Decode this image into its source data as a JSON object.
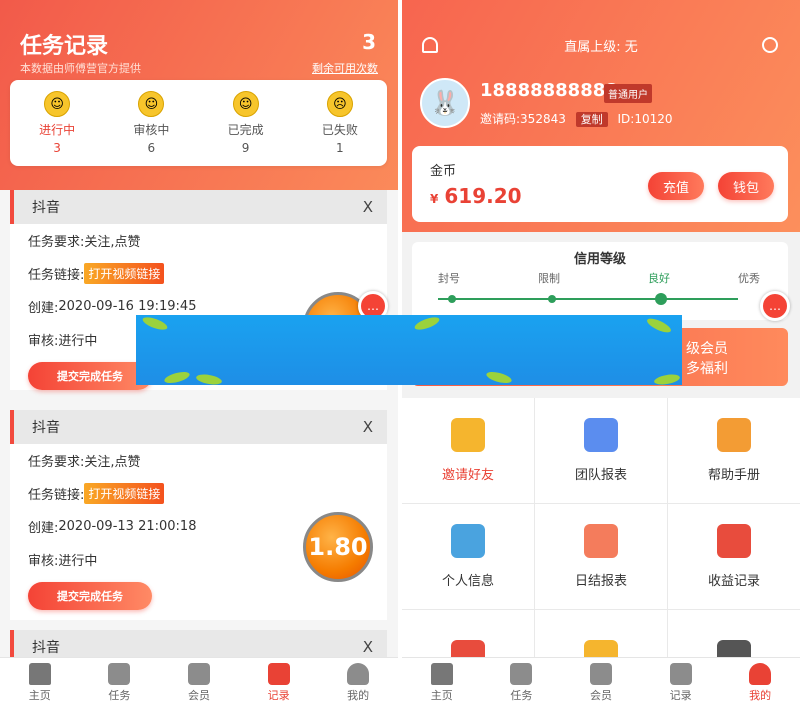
{
  "left": {
    "title": "任务记录",
    "subtitle": "本数据由师傅营官方提供",
    "remaining_count": "3",
    "remaining_label": "剩余可用次数",
    "stats": [
      {
        "label": "进行中",
        "count": "3",
        "active": true
      },
      {
        "label": "审核中",
        "count": "6",
        "active": false
      },
      {
        "label": "已完成",
        "count": "9",
        "active": false
      },
      {
        "label": "已失败",
        "count": "1",
        "active": false
      }
    ],
    "tasks": [
      {
        "platform": "抖音",
        "close": "X",
        "req_label": "任务要求: ",
        "req": "关注,点赞",
        "link_label": "任务链接:",
        "link_btn": "打开视频链接",
        "created_label": "创建: ",
        "created": "2020-09-16 19:19:45",
        "review_label": "审核: ",
        "review": "进行中",
        "submit": "提交完成任务"
      },
      {
        "platform": "抖音",
        "close": "X",
        "req_label": "任务要求: ",
        "req": "关注,点赞",
        "link_label": "任务链接:",
        "link_btn": "打开视频链接",
        "created_label": "创建: ",
        "created": "2020-09-13 21:00:18",
        "review_label": "审核: ",
        "review": "进行中",
        "submit": "提交完成任务",
        "reward": "1.80"
      },
      {
        "platform": "抖音",
        "close": "X"
      }
    ],
    "nav": [
      "主页",
      "任务",
      "会员",
      "记录",
      "我的"
    ],
    "nav_active": 3
  },
  "right": {
    "superior": "直属上级: 无",
    "phone": "18888888888",
    "user_level": "普通用户",
    "invite_label": "邀请码:",
    "invite_code": "352843",
    "copy": "复制",
    "id_label": "ID:",
    "id": "10120",
    "coin_label": "金币",
    "currency": "¥",
    "coin_amount": "619.20",
    "recharge": "充值",
    "wallet": "钱包",
    "credit_title": "信用等级",
    "credit_levels": [
      "封号",
      "限制",
      "良好",
      "优秀"
    ],
    "promo_line1": "级会员",
    "promo_line2": "多福利",
    "menu": [
      {
        "label": "邀请好友",
        "icon": "gift-icon",
        "color": "#f5b52e"
      },
      {
        "label": "团队报表",
        "icon": "layers-icon",
        "color": "#5b8def"
      },
      {
        "label": "帮助手册",
        "icon": "help-icon",
        "color": "#f39c34"
      },
      {
        "label": "个人信息",
        "icon": "id-card-icon",
        "color": "#4aa3df"
      },
      {
        "label": "日结报表",
        "icon": "bar-chart-icon",
        "color": "#f47c5c"
      },
      {
        "label": "收益记录",
        "icon": "money-bag-icon",
        "color": "#e84c3d"
      }
    ],
    "nav": [
      "主页",
      "任务",
      "会员",
      "记录",
      "我的"
    ],
    "nav_active": 4
  },
  "colors": {
    "accent": "#f24a3e",
    "banner": "#1e96ea"
  }
}
